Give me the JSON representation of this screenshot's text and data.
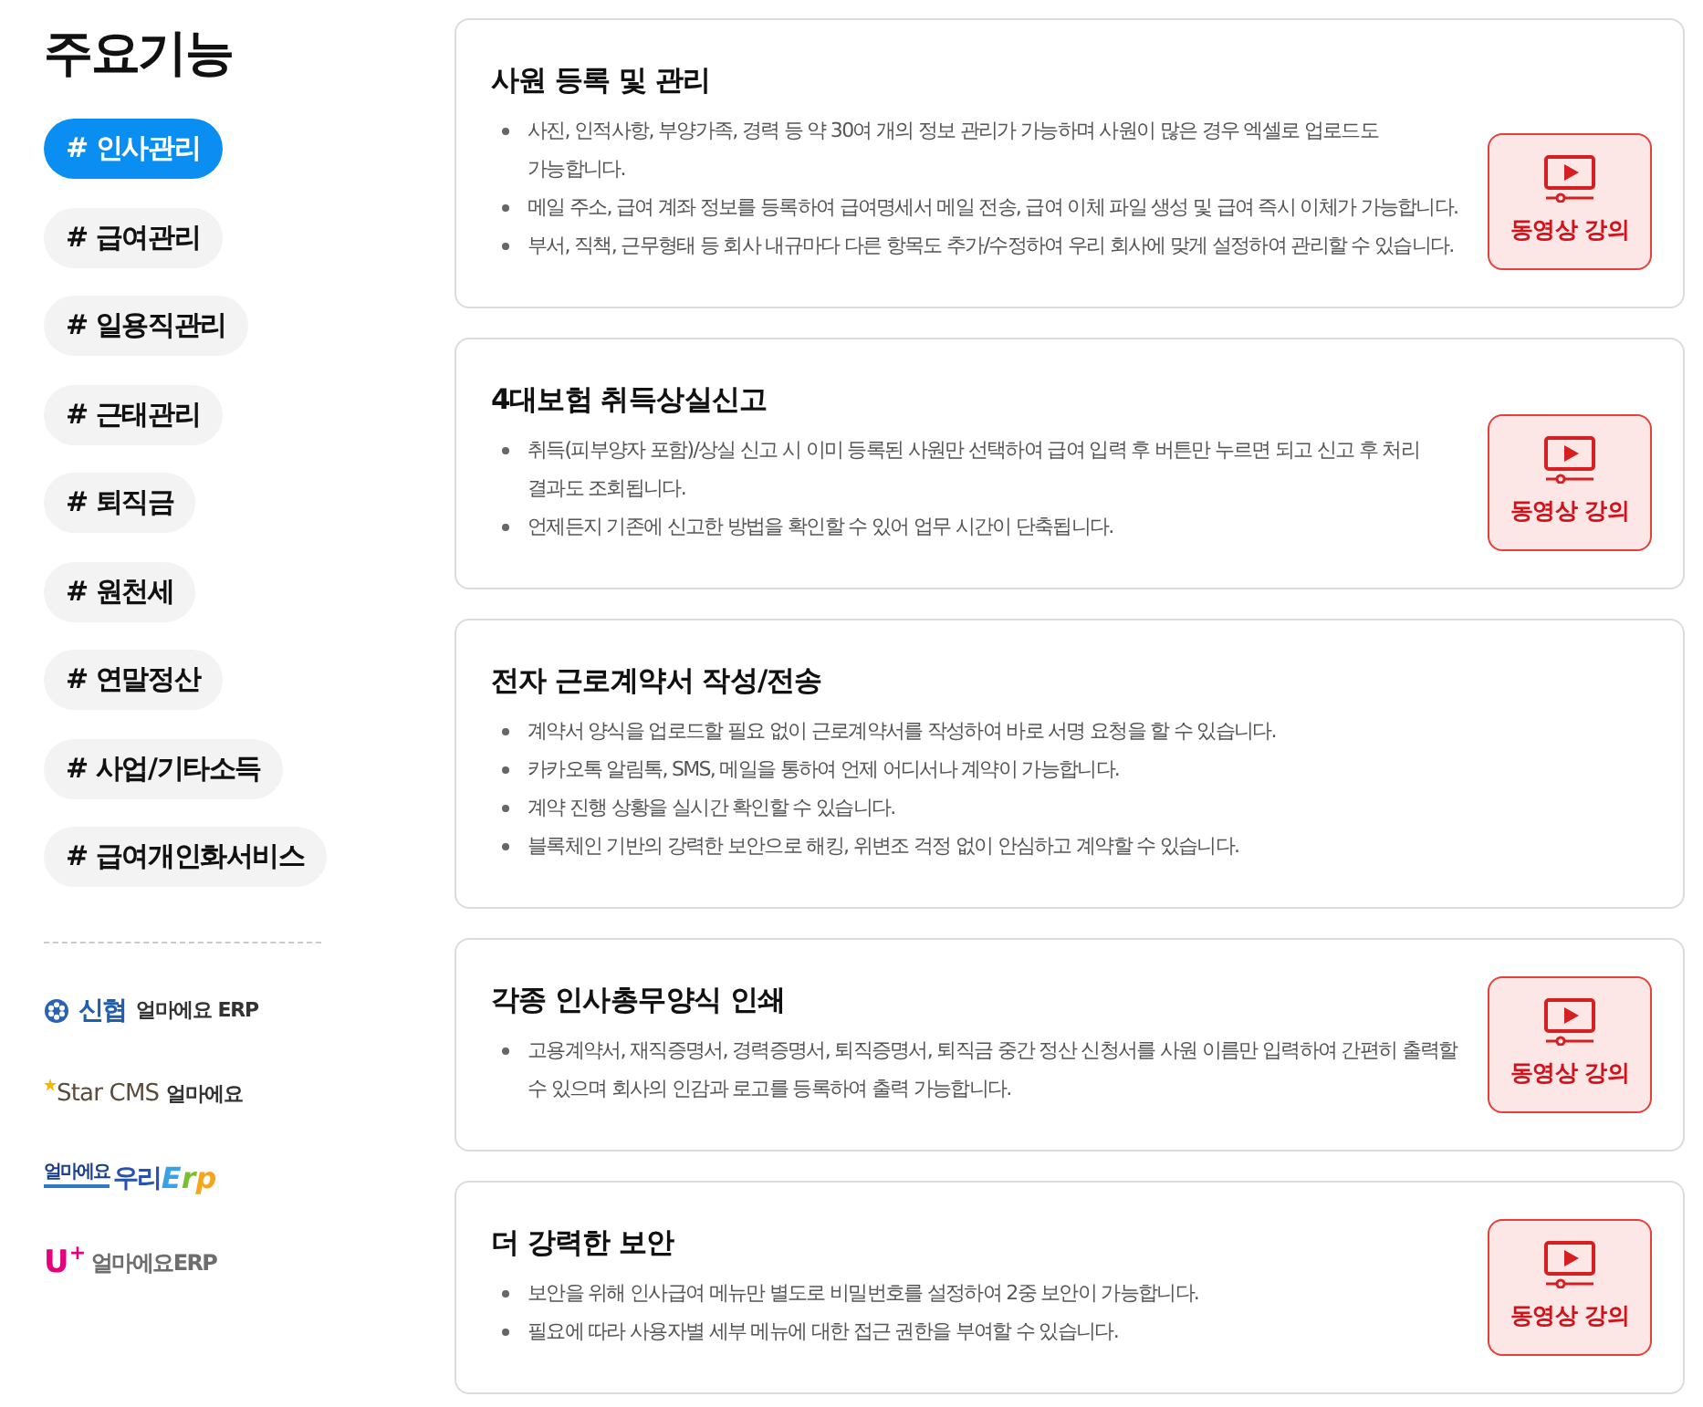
{
  "sidebar": {
    "title": "주요기능",
    "tags": [
      {
        "label": "# 인사관리",
        "selected": true
      },
      {
        "label": "# 급여관리",
        "selected": false
      },
      {
        "label": "# 일용직관리",
        "selected": false
      },
      {
        "label": "# 근태관리",
        "selected": false
      },
      {
        "label": "# 퇴직금",
        "selected": false
      },
      {
        "label": "# 원천세",
        "selected": false
      },
      {
        "label": "# 연말정산",
        "selected": false
      },
      {
        "label": "# 사업/기타소득",
        "selected": false
      },
      {
        "label": "# 급여개인화서비스",
        "selected": false
      }
    ]
  },
  "partners": [
    {
      "kind": "shinhyup",
      "brand": "신협",
      "product": "얼마에요 ERP"
    },
    {
      "kind": "starcms",
      "brand": "Star CMS",
      "product": "얼마에요"
    },
    {
      "kind": "woori",
      "product": "얼마에요",
      "brand": "우리",
      "suffix": "Erp"
    },
    {
      "kind": "uplus",
      "brand": "U$^{+}$",
      "product": "얼마에요ERP"
    }
  ],
  "features": [
    {
      "title": "사원 등록 및 관리",
      "points": [
        "사진, 인적사항, 부양가족, 경력 등 약 30여 개의 정보 관리가 가능하며 사원이 많은 경우 엑셀로 업로드도 가능합니다.",
        "메일 주소, 급여 계좌 정보를 등록하여 급여명세서 메일 전송, 급여 이체 파일 생성 및 급여 즉시 이체가 가능합니다.",
        "부서, 직책, 근무형태 등 회사 내규마다 다른 항목도 추가/수정하여 우리 회사에 맞게 설정하여 관리할 수 있습니다."
      ],
      "video_button": "동영상 강의"
    },
    {
      "title": "4대보험 취득상실신고",
      "points": [
        "취득(피부양자 포함)/상실 신고 시 이미 등록된 사원만 선택하여 급여 입력 후 버튼만 누르면 되고 신고 후 처리 결과도 조회됩니다.",
        "언제든지 기존에 신고한 방법을 확인할 수 있어 업무 시간이 단축됩니다."
      ],
      "video_button": "동영상 강의"
    },
    {
      "title": "전자 근로계약서 작성/전송",
      "points": [
        "계약서 양식을 업로드할 필요 없이 근로계약서를 작성하여 바로 서명 요청을 할 수 있습니다.",
        "카카오톡 알림톡, SMS, 메일을 통하여 언제 어디서나 계약이 가능합니다.",
        "계약 진행 상황을 실시간 확인할 수 있습니다.",
        "블록체인 기반의 강력한 보안으로 해킹, 위변조 걱정 없이 안심하고 계약할 수 있습니다."
      ]
    },
    {
      "title": "각종 인사총무양식 인쇄",
      "points": [
        "고용계약서, 재직증명서, 경력증명서, 퇴직증명서, 퇴직금 중간 정산 신청서를 사원 이름만 입력하여 간편히 출력할 수 있으며 회사의 인감과 로고를 등록하여 출력 가능합니다."
      ],
      "video_button": "동영상 강의"
    },
    {
      "title": "더 강력한 보안",
      "points": [
        "보안을 위해 인사급여 메뉴만 별도로 비밀번호를 설정하여 2중 보안이 가능합니다.",
        "필요에 따라 사용자별 세부 메뉴에 대한 접근 권한을 부여할 수 있습니다."
      ],
      "video_button": "동영상 강의"
    }
  ]
}
